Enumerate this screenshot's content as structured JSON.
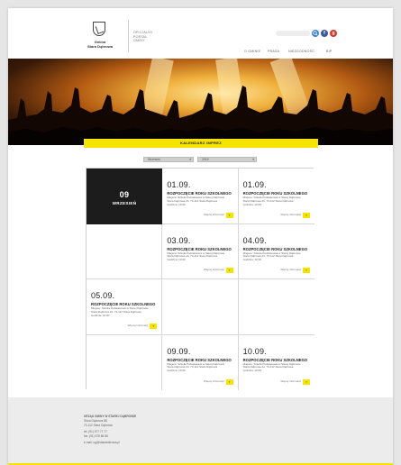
{
  "header": {
    "logo_line1": "Gmina",
    "logo_line2": "Stara Dąbrowa",
    "portal_line1": "OFICJALNY",
    "portal_line2": "PORTAL",
    "portal_line3": "GMINY",
    "nav": [
      "O GMINIE",
      "PRASA",
      "NIEZGODNOŚĆ",
      "BIP"
    ]
  },
  "banner": "KALENDARZ IMPREZ",
  "filters": {
    "month": "Wrzesień",
    "year": "2015"
  },
  "calendar": {
    "month_num": "09",
    "month_name": "WRZESIEŃ",
    "events": [
      {
        "date": "01.09.",
        "title": "ROZPOCZĘCIE ROKU SZKOLNEGO",
        "desc1": "Miejsce: Szkoła Podstawowa w Starej Dąbrowie",
        "desc2": "Stara Dąbrowa 24, 73-112 Stara Dąbrowa",
        "desc3": "Godzina: 10:00",
        "more": "Więcej informacji"
      },
      {
        "date": "01.09.",
        "title": "ROZPOCZĘCIE ROKU SZKOLNEGO",
        "desc1": "Miejsce: Szkoła Podstawowa w Starej Dąbrowie",
        "desc2": "Stara Dąbrowa 24, 73-112 Stara Dąbrowa",
        "desc3": "Godzina: 10:00",
        "more": "Więcej informacji"
      },
      {
        "date": "03.09.",
        "title": "ROZPOCZĘCIE ROKU SZKOLNEGO",
        "desc1": "Miejsce: Szkoła Podstawowa w Starej Dąbrowie",
        "desc2": "Stara Dąbrowa 24, 73-112 Stara Dąbrowa",
        "desc3": "Godzina: 10:00",
        "more": "Więcej informacji"
      },
      {
        "date": "04.09.",
        "title": "ROZPOCZĘCIE ROKU SZKOLNEGO",
        "desc1": "Miejsce: Szkoła Podstawowa w Starej Dąbrowie",
        "desc2": "Stara Dąbrowa 24, 73-112 Stara Dąbrowa",
        "desc3": "Godzina: 10:00",
        "more": "Więcej informacji"
      },
      {
        "date": "05.09.",
        "title": "ROZPOCZĘCIE ROKU SZKOLNEGO",
        "desc1": "Miejsce: Szkoła Podstawowa w Starej Dąbrowie",
        "desc2": "Stara Dąbrowa 24, 73-112 Stara Dąbrowa",
        "desc3": "Godzina: 10:00",
        "more": "Więcej informacji"
      },
      {
        "date": "09.09.",
        "title": "ROZPOCZĘCIE ROKU SZKOLNEGO",
        "desc1": "Miejsce: Szkoła Podstawowa w Starej Dąbrowie",
        "desc2": "Stara Dąbrowa 24, 73-112 Stara Dąbrowa",
        "desc3": "Godzina: 10:00",
        "more": "Więcej informacji"
      },
      {
        "date": "10.09.",
        "title": "ROZPOCZĘCIE ROKU SZKOLNEGO",
        "desc1": "Miejsce: Szkoła Podstawowa w Starej Dąbrowie",
        "desc2": "Stara Dąbrowa 24, 73-112 Stara Dąbrowa",
        "desc3": "Godzina: 10:00",
        "more": "Więcej informacji"
      }
    ]
  },
  "footer": {
    "line1": "URZĄD GMINY W STAREJ DĄBROWIE",
    "line2": "Stara Dąbrowa 88",
    "line3": "73-112 Stara Dąbrowa",
    "tel": "tel. (91) 577 77 77",
    "fax": "fax. (91) 578 88 88",
    "email": "e-mail: ug@staradabrowa.pl"
  },
  "colors": {
    "accent": "#f5e300",
    "dark": "#1c1c1c",
    "search_blue": "#3c7fd0",
    "facebook_blue": "#3b5998",
    "google_red": "#d23a2a"
  },
  "icons": {
    "search": "search-icon",
    "facebook": "facebook-icon",
    "google": "google-plus-icon",
    "arrow": "arrow-right-icon",
    "dropdown": "chevron-down-icon",
    "crest": "crest-icon"
  }
}
